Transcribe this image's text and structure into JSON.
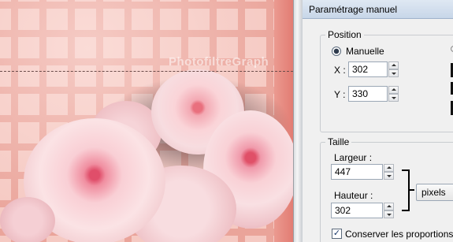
{
  "canvas": {
    "watermark": "PhotofiltreGraph"
  },
  "dialog": {
    "title": "Paramétrage manuel",
    "position": {
      "group_label": "Position",
      "mode_label": "Manuelle",
      "mode_selected": true,
      "x_label": "X :",
      "x_value": "302",
      "y_label": "Y :",
      "y_value": "330"
    },
    "size": {
      "group_label": "Taille",
      "width_label": "Largeur :",
      "width_value": "447",
      "height_label": "Hauteur :",
      "height_value": "302",
      "unit": "pixels"
    },
    "keep_proportions": {
      "label": "Conserver les proportions",
      "checked": true
    }
  },
  "icons": {
    "radio": "radio-selected-icon",
    "spin_up": "spin-up-icon",
    "spin_down": "spin-down-icon",
    "check": "checkmark-icon"
  },
  "colors": {
    "canvas_pink": "#f5c9c2",
    "grid_lines": "#eaa49a",
    "dialog_bg": "#f0f0f0",
    "titlebar": "#c7d6e8"
  }
}
